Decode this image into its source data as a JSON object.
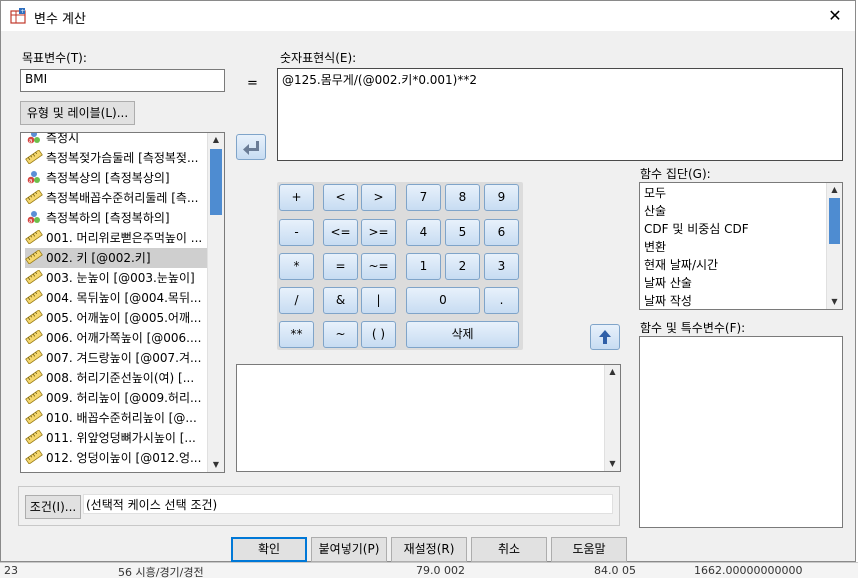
{
  "window": {
    "title": "변수 계산",
    "close_glyph": "✕"
  },
  "target": {
    "label": "목표변수(T):",
    "value": "BMI",
    "type_label_button": "유형 및 레이블(L)..."
  },
  "equals_sign": "=",
  "expression": {
    "label": "숫자표현식(E):",
    "value": "@125.몸무게/(@002.키*0.001)**2"
  },
  "variables": [
    {
      "label": "측정시",
      "icon": "nominal-icon"
    },
    {
      "label": "측정복젖가슴둘레 [측정복젖...",
      "icon": "ruler-icon"
    },
    {
      "label": "측정복상의 [측정복상의]",
      "icon": "nominal-icon"
    },
    {
      "label": "측정복배꼽수준허리둘레 [측...",
      "icon": "ruler-icon"
    },
    {
      "label": "측정복하의 [측정복하의]",
      "icon": "nominal-icon"
    },
    {
      "label": "001. 머리위로뻗은주먹높이 ...",
      "icon": "ruler-icon"
    },
    {
      "label": "002. 키 [@002.키]",
      "icon": "ruler-icon",
      "selected": true
    },
    {
      "label": "003. 눈높이 [@003.눈높이]",
      "icon": "ruler-icon"
    },
    {
      "label": "004. 목뒤높이 [@004.목뒤...",
      "icon": "ruler-icon"
    },
    {
      "label": "005. 어깨높이 [@005.어깨...",
      "icon": "ruler-icon"
    },
    {
      "label": "006. 어깨가쪽높이 [@006....",
      "icon": "ruler-icon"
    },
    {
      "label": "007. 겨드랑높이 [@007.겨...",
      "icon": "ruler-icon"
    },
    {
      "label": "008. 허리기준선높이(여) [...",
      "icon": "ruler-icon"
    },
    {
      "label": "009. 허리높이 [@009.허리...",
      "icon": "ruler-icon"
    },
    {
      "label": "010. 배꼽수준허리높이 [@...",
      "icon": "ruler-icon"
    },
    {
      "label": "011. 위앞엉덩뼈가시높이 [...",
      "icon": "ruler-icon"
    },
    {
      "label": "012. 엉덩이높이 [@012.엉...",
      "icon": "ruler-icon"
    }
  ],
  "keypad": [
    [
      "+",
      "<",
      ">",
      "7",
      "8",
      "9"
    ],
    [
      "-",
      "<=",
      ">=",
      "4",
      "5",
      "6"
    ],
    [
      "*",
      "=",
      "~=",
      "1",
      "2",
      "3"
    ],
    [
      "/",
      "&",
      "|",
      "0",
      "."
    ],
    [
      "**",
      "~",
      "( )",
      "삭제"
    ]
  ],
  "function_groups": {
    "label": "함수 집단(G):",
    "items": [
      "모두",
      "산술",
      "CDF 및 비중심 CDF",
      "변환",
      "현재 날짜/시간",
      "날짜 산술",
      "날짜 작성"
    ]
  },
  "functions": {
    "label": "함수 및 특수변수(F):"
  },
  "if_condition": {
    "button": "조건(I)...",
    "text": "(선택적 케이스 선택 조건)"
  },
  "footer": {
    "ok": "확인",
    "paste": "붙여넣기(P)",
    "reset": "재설정(R)",
    "cancel": "취소",
    "help": "도움말"
  },
  "background_row": [
    "23",
    "56 시흥/경기/경전",
    "79.0 002",
    "84.0 05",
    "1662.00000000000"
  ],
  "colors": {
    "dialog_bg": "#f0f0f0",
    "accent_blue": "#0078d7",
    "scroll_thumb": "#4e8cd1",
    "keypad_button_top": "#e8f1fb",
    "keypad_button_bottom": "#c7dcf2"
  }
}
